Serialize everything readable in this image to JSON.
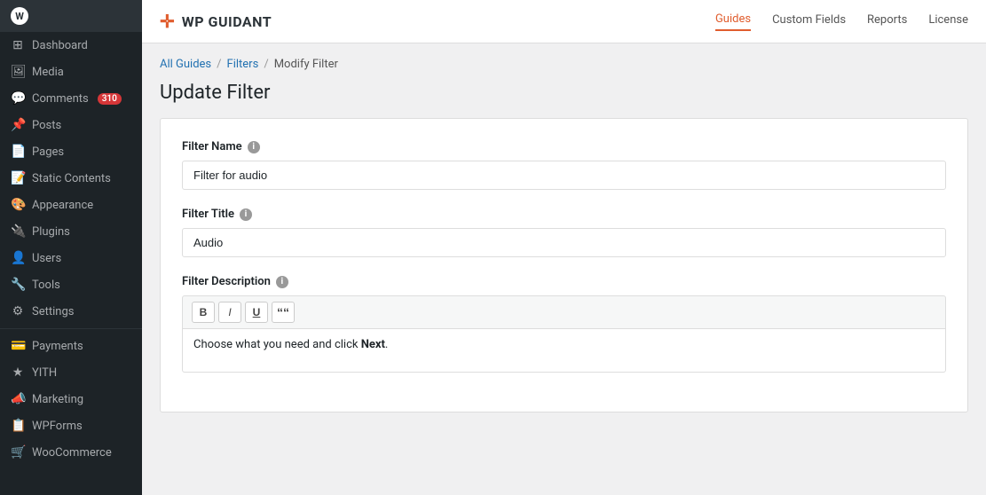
{
  "sidebar": {
    "logo": "WP",
    "items": [
      {
        "id": "dashboard",
        "label": "Dashboard",
        "icon": "⊞"
      },
      {
        "id": "media",
        "label": "Media",
        "icon": "🖼"
      },
      {
        "id": "comments",
        "label": "Comments",
        "icon": "💬",
        "badge": "310"
      },
      {
        "id": "posts",
        "label": "Posts",
        "icon": "📌"
      },
      {
        "id": "pages",
        "label": "Pages",
        "icon": "📄"
      },
      {
        "id": "static-contents",
        "label": "Static Contents",
        "icon": "📝"
      },
      {
        "id": "appearance",
        "label": "Appearance",
        "icon": "🎨"
      },
      {
        "id": "plugins",
        "label": "Plugins",
        "icon": "🔌"
      },
      {
        "id": "users",
        "label": "Users",
        "icon": "👤"
      },
      {
        "id": "tools",
        "label": "Tools",
        "icon": "🔧"
      },
      {
        "id": "settings",
        "label": "Settings",
        "icon": "⚙"
      },
      {
        "id": "payments",
        "label": "Payments",
        "icon": "💳"
      },
      {
        "id": "yith",
        "label": "YITH",
        "icon": "★"
      },
      {
        "id": "marketing",
        "label": "Marketing",
        "icon": "📣"
      },
      {
        "id": "wpforms",
        "label": "WPForms",
        "icon": "📋"
      },
      {
        "id": "woocommerce",
        "label": "WooCommerce",
        "icon": "🛒"
      }
    ]
  },
  "topnav": {
    "brand": "WP GUIDANT",
    "cross_symbol": "✛",
    "links": [
      {
        "id": "guides",
        "label": "Guides",
        "active": true
      },
      {
        "id": "custom-fields",
        "label": "Custom Fields",
        "active": false
      },
      {
        "id": "reports",
        "label": "Reports",
        "active": false
      },
      {
        "id": "license",
        "label": "License",
        "active": false
      }
    ]
  },
  "breadcrumb": {
    "items": [
      {
        "label": "All Guides",
        "link": true
      },
      {
        "label": "Filters",
        "link": true
      },
      {
        "label": "Modify Filter",
        "link": false
      }
    ]
  },
  "page": {
    "title": "Update Filter",
    "form": {
      "filter_name": {
        "label": "Filter Name",
        "value": "Filter for audio"
      },
      "filter_title": {
        "label": "Filter Title",
        "value": "Audio"
      },
      "filter_description": {
        "label": "Filter Description",
        "toolbar": {
          "bold": "B",
          "italic": "I",
          "underline": "U",
          "quote": "““"
        },
        "content_prefix": "Choose what you need and click ",
        "content_bold": "Next",
        "content_suffix": "."
      }
    }
  }
}
